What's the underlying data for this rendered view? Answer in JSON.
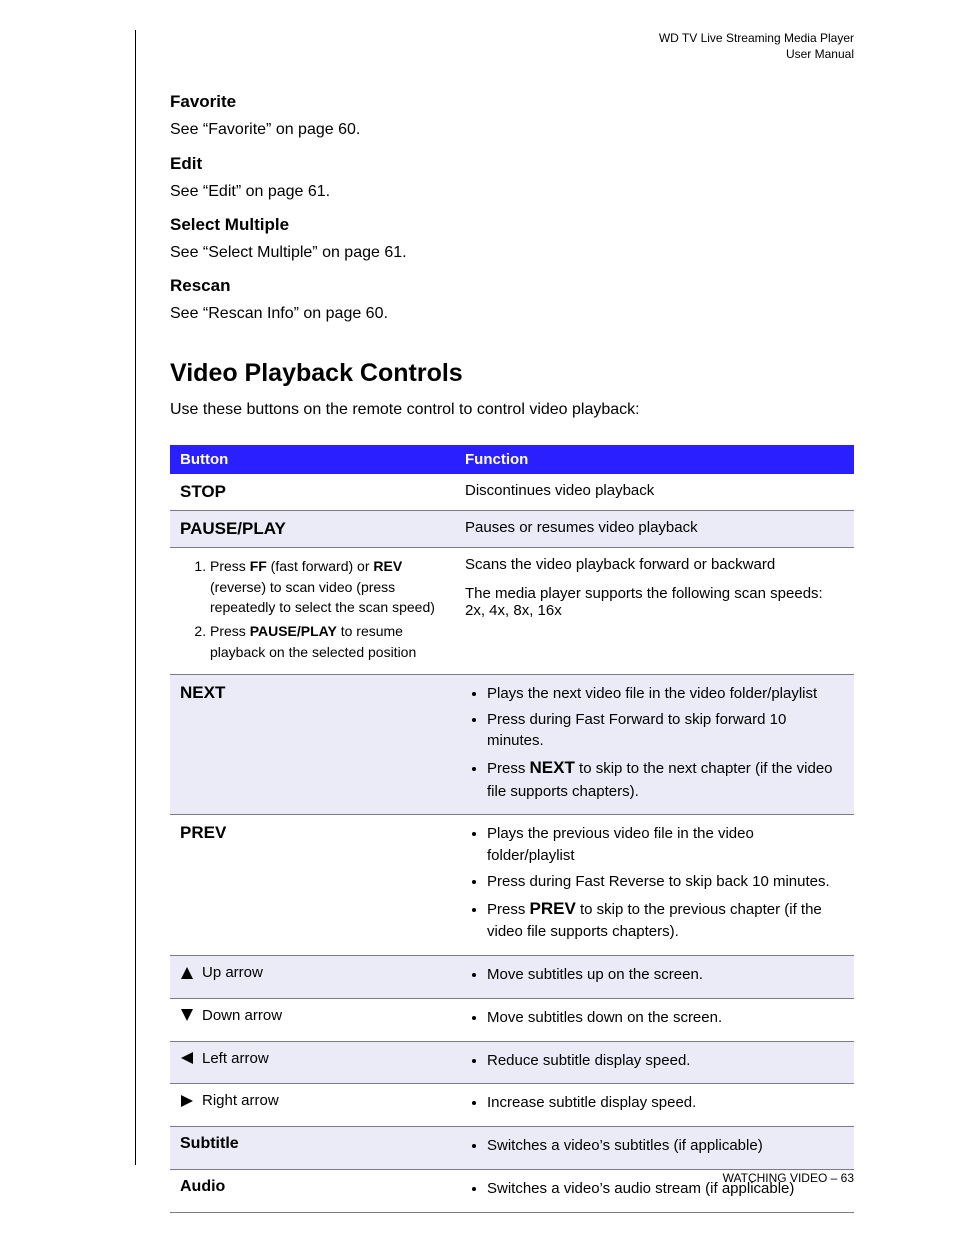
{
  "header": {
    "line1": "WD TV Live Streaming Media Player",
    "line2": "User Manual"
  },
  "sections": {
    "favorite": {
      "heading": "Favorite",
      "body": "See “Favorite” on page 60."
    },
    "edit": {
      "heading": "Edit",
      "body": "See “Edit” on page 61."
    },
    "selectmultiple": {
      "heading": "Select Multiple",
      "body": "See “Select Multiple” on page 61."
    },
    "rescan": {
      "heading": "Rescan",
      "body": "See “Rescan Info” on page 60."
    }
  },
  "playback": {
    "title": "Video Playback Controls",
    "intro": "Use these buttons on the remote control to control video playback:"
  },
  "table": {
    "header_button": "Button",
    "header_function": "Function",
    "rows": {
      "stop": {
        "label": "STOP",
        "function": "Discontinues video playback"
      },
      "pauseplay": {
        "label": "PAUSE/PLAY",
        "function": "Pauses or resumes video playback"
      },
      "scan": {
        "step1_pre": "Press ",
        "step1_ff": "FF",
        "step1_mid": " (fast forward) or ",
        "step1_rev": "REV",
        "step1_post": " (reverse) to scan video (press repeatedly to select the scan speed)",
        "step2_pre": "Press ",
        "step2_pp": "PAUSE/PLAY",
        "step2_post": " to resume playback on the selected position",
        "func_line1": "Scans the video playback forward or backward",
        "func_line2": "The media player supports the following scan speeds: 2x, 4x, 8x, 16x"
      },
      "next": {
        "label": "NEXT",
        "li1": "Plays the next video file in the video folder/playlist",
        "li2": "Press during Fast Forward to skip forward 10 minutes.",
        "li3_pre": "Press ",
        "li3_bold": "NEXT",
        "li3_post": " to skip to the next chapter (if the video file supports chapters)."
      },
      "prev": {
        "label": "PREV",
        "li1": "Plays the previous video file in the video folder/playlist",
        "li2": "Press during Fast Reverse to skip back 10 minutes.",
        "li3_pre": "Press ",
        "li3_bold": "PREV",
        "li3_post": " to skip to the previous chapter (if the video file supports chapters)."
      },
      "up": {
        "label": "Up arrow",
        "func": "Move subtitles up on the screen."
      },
      "down": {
        "label": "Down arrow",
        "func": "Move subtitles down on the screen."
      },
      "left": {
        "label": "Left arrow",
        "func": "Reduce subtitle display speed."
      },
      "right": {
        "label": "Right arrow",
        "func": "Increase subtitle display speed."
      },
      "subtitle": {
        "label": "Subtitle",
        "func": "Switches a video’s subtitles (if applicable)"
      },
      "audio": {
        "label": "Audio",
        "func": "Switches a video’s audio stream (if applicable)"
      }
    }
  },
  "footer": {
    "section": "WATCHING VIDEO",
    "sep": " – ",
    "page": "63"
  }
}
